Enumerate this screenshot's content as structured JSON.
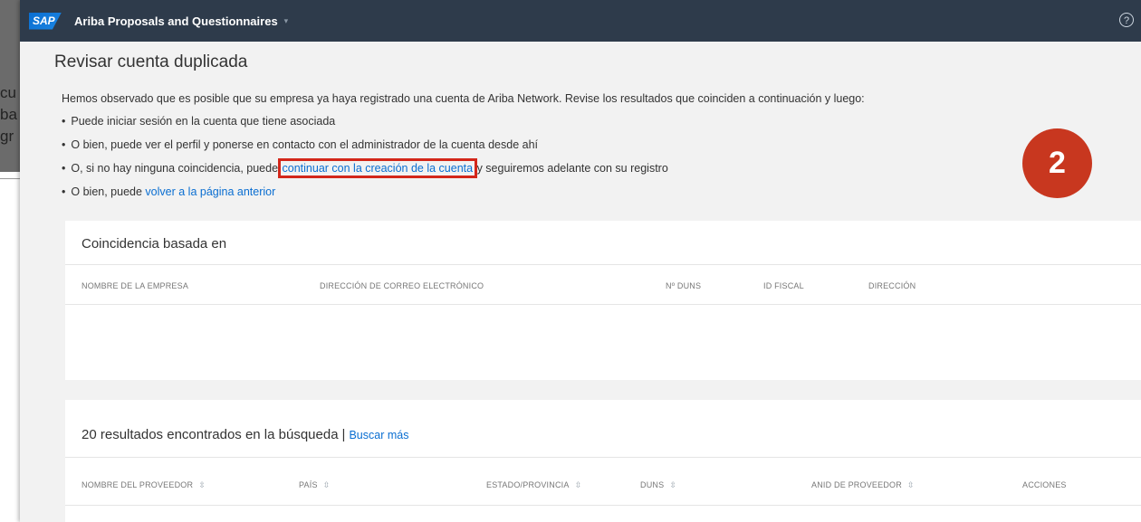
{
  "background_fragment": {
    "lines": [
      "cu",
      "ba",
      "gr"
    ]
  },
  "header": {
    "logo": "SAP",
    "title": "Ariba Proposals and Questionnaires",
    "caret": "▾",
    "help": "?"
  },
  "page_title": "Revisar cuenta duplicada",
  "intro": "Hemos observado que es posible que su empresa ya haya registrado una cuenta de Ariba Network. Revise los resultados que coinciden a continuación y luego:",
  "bullets": {
    "b1": "Puede iniciar sesión en la cuenta que tiene asociada",
    "b2": "O bien, puede ver el perfil y ponerse en contacto con el administrador de la cuenta desde ahí",
    "b3_pre": "O, si no hay ninguna coincidencia, puede",
    "b3_link": "continuar con la creación de la cuenta",
    "b3_post": "y seguiremos adelante con su registro",
    "b4_pre": "O bien, puede",
    "b4_link": "volver a la página anterior"
  },
  "badge": "2",
  "match_panel": {
    "title": "Coincidencia basada en",
    "columns": [
      "NOMBRE DE LA EMPRESA",
      "DIRECCIÓN DE CORREO ELECTRÓNICO",
      "Nº DUNS",
      "ID FISCAL",
      "DIRECCIÓN"
    ]
  },
  "results_panel": {
    "title": "20 resultados encontrados en la búsqueda",
    "separator": "|",
    "search_more": "Buscar más",
    "columns": [
      "NOMBRE DEL PROVEEDOR",
      "PAÍS",
      "ESTADO/PROVINCIA",
      "DUNS",
      "ANID DE PROVEEDOR",
      "ACCIONES"
    ]
  },
  "colors": {
    "topbar": "#2e3b4b",
    "link": "#0a6ed1",
    "highlight": "#d3271a",
    "badge": "#c8371f"
  }
}
